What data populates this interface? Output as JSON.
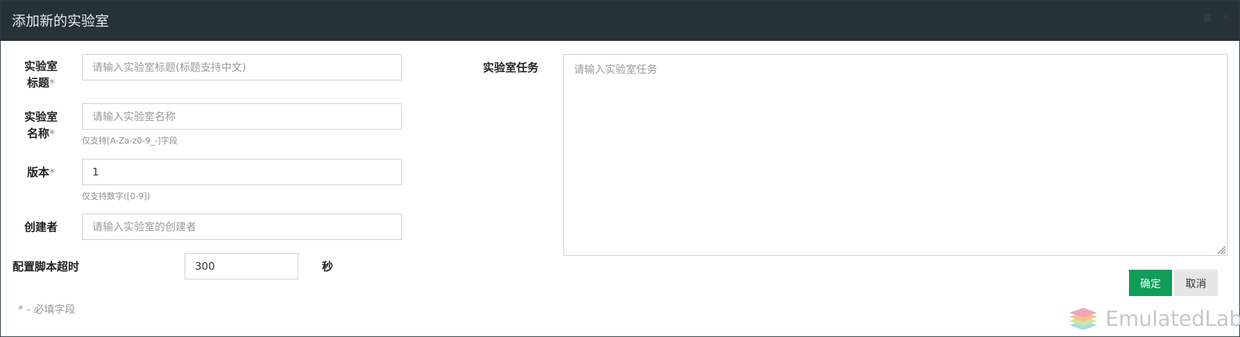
{
  "modal": {
    "title": "添加新的实验室"
  },
  "form": {
    "title_label_line1": "实验室",
    "title_label_line2": "标题",
    "title_placeholder": "请输入实验室标题(标题支持中文)",
    "name_label_line1": "实验室",
    "name_label_line2": "名称",
    "name_placeholder": "请输入实验室名称",
    "name_hint": "仅支持[A-Za-z0-9_-]字段",
    "version_label": "版本",
    "version_value": "1",
    "version_hint": "仅支持数字([0-9])",
    "creator_label": "创建者",
    "creator_placeholder": "请输入实验室的创建者",
    "timeout_label": "配置脚本超时",
    "timeout_value": "300",
    "timeout_unit": "秒",
    "task_label": "实验室任务",
    "task_placeholder": "请输入实验室任务",
    "required_mark": "*",
    "footnote": "* - 必填字段"
  },
  "actions": {
    "confirm_label": "确定",
    "cancel_label": "取消"
  },
  "branding": {
    "logo_text": "EmulatedLab"
  }
}
